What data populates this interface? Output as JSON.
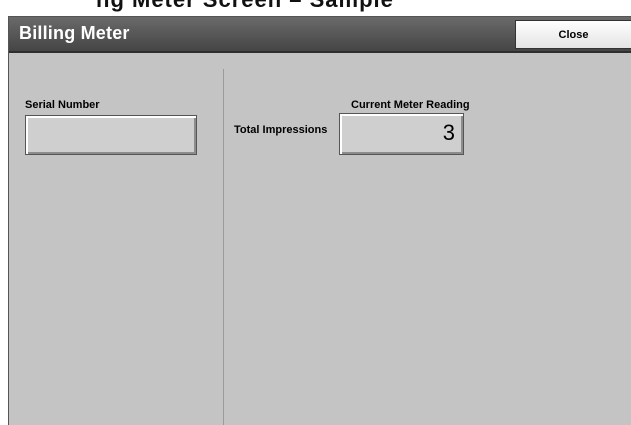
{
  "header_fragment": "ng Meter Screen – Sample",
  "window": {
    "title": "Billing Meter",
    "close_label": "Close"
  },
  "serial": {
    "label": "Serial Number",
    "value": ""
  },
  "meter": {
    "heading": "Current Meter Reading",
    "row_label": "Total Impressions",
    "value": "3"
  },
  "colors": {
    "title_bar": "#4f4f4f",
    "panel_background": "#c4c4c4",
    "close_button": "#f2f2f2"
  }
}
